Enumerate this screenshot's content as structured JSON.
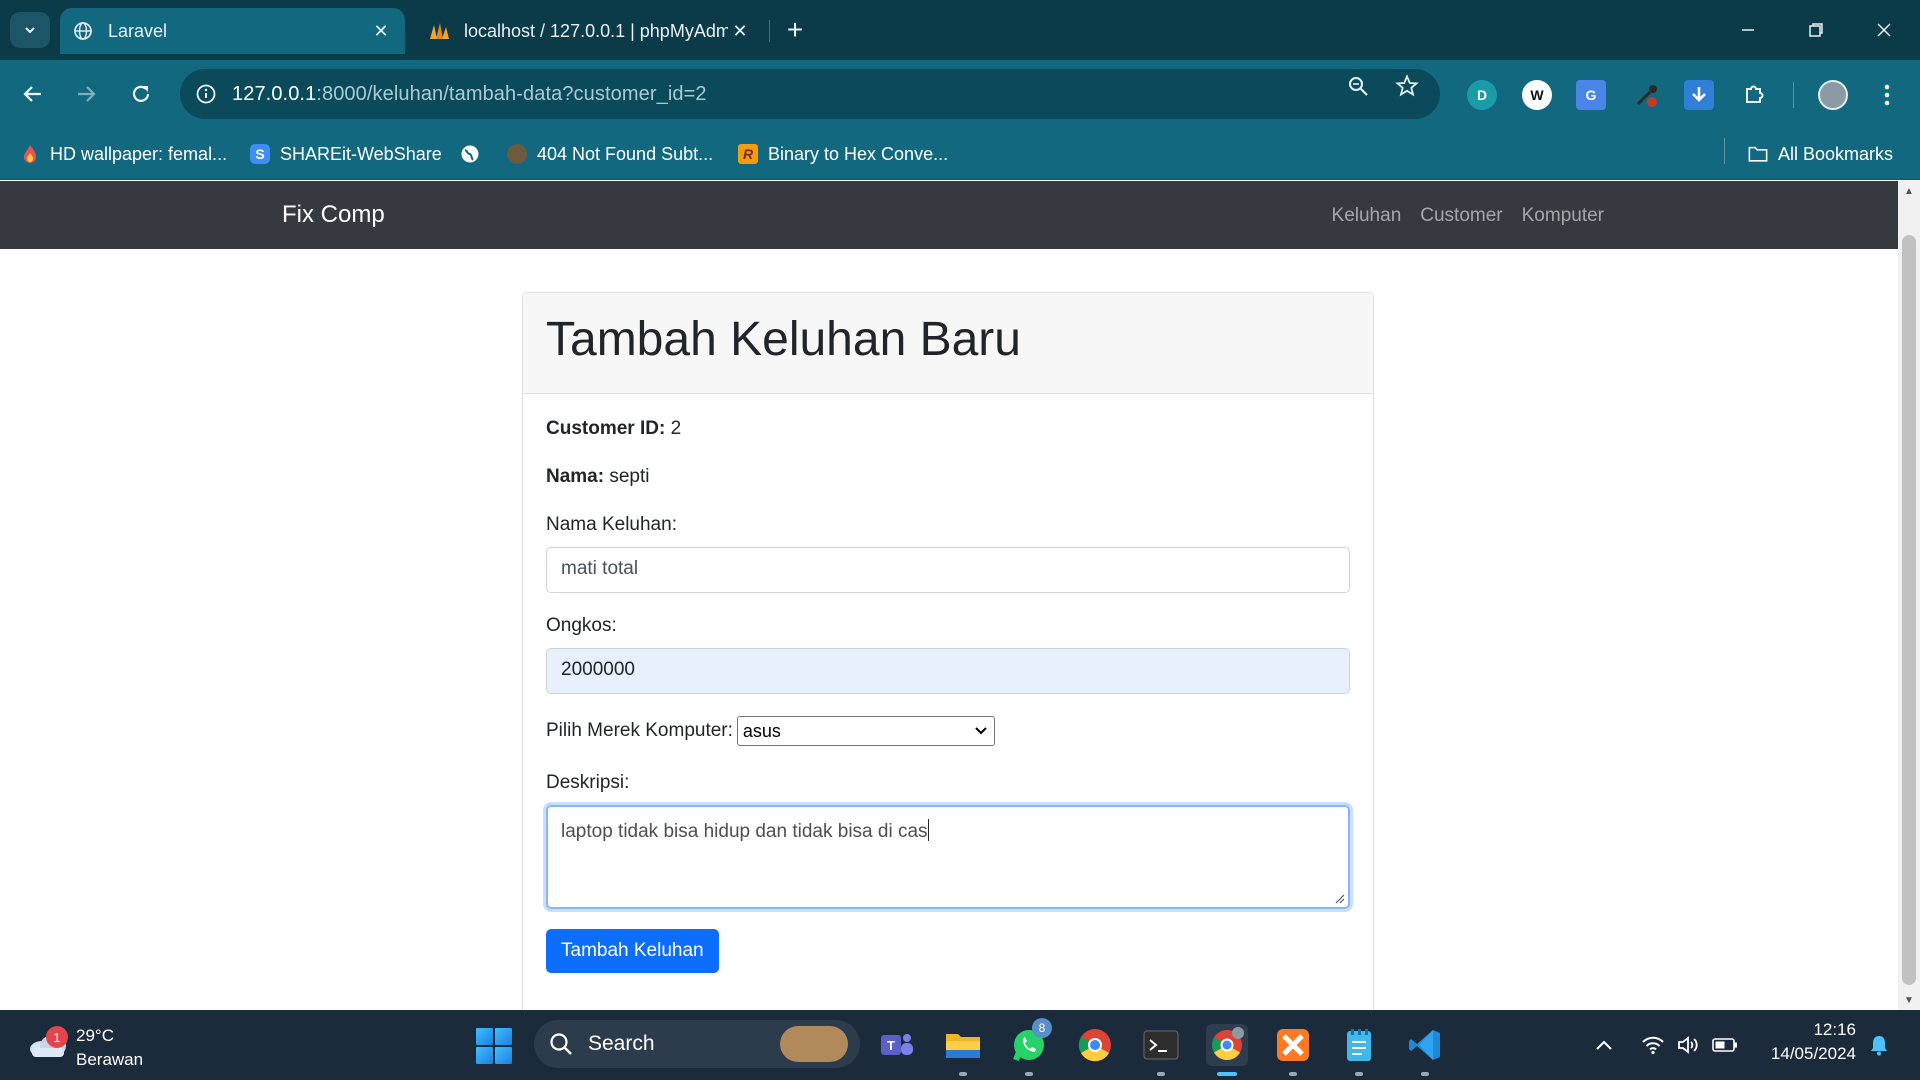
{
  "browser": {
    "tabs": [
      {
        "title": "Laravel",
        "active": true
      },
      {
        "title": "localhost / 127.0.0.1 | phpMyAdmin",
        "active": false
      }
    ],
    "url_host": "127.0.0.1",
    "url_rest": ":8000/keluhan/tambah-data?customer_id=2",
    "bookmarks": [
      {
        "label": "HD wallpaper: femal..."
      },
      {
        "label": "SHAREit-WebShare"
      },
      {
        "label": ""
      },
      {
        "label": "404 Not Found Subt..."
      },
      {
        "label": "Binary to Hex Conve..."
      }
    ],
    "all_bookmarks": "All Bookmarks"
  },
  "site": {
    "brand": "Fix Comp",
    "nav": [
      "Keluhan",
      "Customer",
      "Komputer"
    ]
  },
  "form": {
    "heading": "Tambah Keluhan Baru",
    "customer_id_label": "Customer ID:",
    "customer_id_value": "2",
    "nama_label": "Nama:",
    "nama_value": "septi",
    "nama_keluhan_label": "Nama Keluhan:",
    "nama_keluhan_value": "mati total",
    "ongkos_label": "Ongkos:",
    "ongkos_value": "2000000",
    "merek_label": "Pilih Merek Komputer:",
    "merek_value": "asus",
    "deskripsi_label": "Deskripsi:",
    "deskripsi_value": "laptop tidak bisa hidup dan tidak bisa di cas",
    "submit_label": "Tambah Keluhan"
  },
  "taskbar": {
    "weather_temp": "29°C",
    "weather_cond": "Berawan",
    "weather_badge": "1",
    "search_label": "Search",
    "whatsapp_badge": "8",
    "time": "12:16",
    "date": "14/05/2024"
  },
  "colors": {
    "tabstrip": "#0b3b49",
    "toolbar": "#11687f",
    "navbar": "#343a40",
    "primary": "#0d6efd",
    "taskbar": "#1c2b3c"
  }
}
